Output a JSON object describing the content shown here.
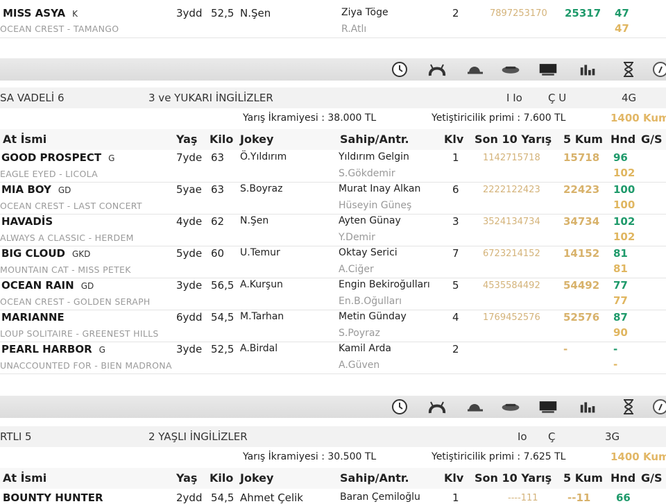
{
  "top_entry": {
    "name": "MISS ASYA",
    "tag": "K",
    "age": "3ydd",
    "kilo": "52,5",
    "jockey": "N.Şen",
    "owner": "Ziya Töge",
    "trainer": "R.Atlı",
    "klv": "2",
    "form": "7897253170",
    "kum": "25317",
    "hnd": "47",
    "hnd2": "47",
    "pedigree": "OCEAN CREST - TAMANGO"
  },
  "icons": [
    "clock-icon",
    "horseshoe-icon",
    "jockey-cap-icon",
    "saddle-icon",
    "tv-icon",
    "stats-icon",
    "hourglass-icon",
    "info-icon"
  ],
  "race1": {
    "title": "SA VADELİ 6",
    "category": "3 ve YUKARI İNGİLİZLER",
    "cond1": "I Io",
    "cond2": "Ç U",
    "cond3": "4G",
    "prize_label": "Yarış İkramiyesi : 38.000 TL",
    "breeder_label": "Yetiştiricilik primi : 7.600 TL",
    "distance": "1400 Kum",
    "headers": {
      "name": "At İsmi",
      "age": "Yaş",
      "kilo": "Kilo",
      "jockey": "Jokey",
      "owner": "Sahip/Antr.",
      "klv": "Klv",
      "form": "Son 10 Yarış",
      "kum": "5 Kum",
      "hnd": "Hnd",
      "gs": "G/S"
    },
    "rows": [
      {
        "name": "GOOD PROSPECT",
        "tag": "G",
        "pedigree": "EAGLE EYED - LICOLA",
        "age": "7yde",
        "kilo": "63",
        "jockey": "Ö.Yıldırım",
        "owner": "Yıldırım Gelgin",
        "trainer": "S.Gökdemir",
        "klv": "1",
        "form": "1142715718",
        "kum": "15718",
        "hnd": "96",
        "hnd2": "102"
      },
      {
        "name": "MIA BOY",
        "tag": "GD",
        "pedigree": "OCEAN CREST - LAST CONCERT",
        "age": "5yae",
        "kilo": "63",
        "jockey": "S.Boyraz",
        "owner": "Murat Inay Alkan",
        "trainer": "Hüseyin Güneş",
        "klv": "6",
        "form": "2222122423",
        "kum": "22423",
        "hnd": "100",
        "hnd2": "100"
      },
      {
        "name": "HAVADİS",
        "tag": "",
        "pedigree": "ALWAYS A CLASSIC - HERDEM",
        "age": "4yde",
        "kilo": "62",
        "jockey": "N.Şen",
        "owner": "Ayten Günay",
        "trainer": "Y.Demir",
        "klv": "3",
        "form": "3524134734",
        "kum": "34734",
        "hnd": "102",
        "hnd2": "102"
      },
      {
        "name": "BIG CLOUD",
        "tag": "GKD",
        "pedigree": "MOUNTAIN CAT - MISS PETEK",
        "age": "5yde",
        "kilo": "60",
        "jockey": "U.Temur",
        "owner": "Oktay Serici",
        "trainer": "A.Ciğer",
        "klv": "7",
        "form": "6723214152",
        "kum": "14152",
        "hnd": "81",
        "hnd2": "81"
      },
      {
        "name": "OCEAN RAIN",
        "tag": "GD",
        "pedigree": "OCEAN CREST - GOLDEN SERAPH",
        "age": "3yde",
        "kilo": "56,5",
        "jockey": "A.Kurşun",
        "owner": "Engin Bekiroğulları",
        "trainer": "En.B.Oğulları",
        "klv": "5",
        "form": "4535584492",
        "kum": "54492",
        "hnd": "77",
        "hnd2": "77"
      },
      {
        "name": "MARIANNE",
        "tag": "",
        "pedigree": "LOUP SOLITAIRE - GREENEST HILLS",
        "age": "6ydd",
        "kilo": "54,5",
        "jockey": "M.Tarhan",
        "owner": "Metin Günday",
        "trainer": "S.Poyraz",
        "klv": "4",
        "form": "1769452576",
        "kum": "52576",
        "hnd": "87",
        "hnd2": "90"
      },
      {
        "name": "PEARL HARBOR",
        "tag": "G",
        "pedigree": "UNACCOUNTED FOR - BIEN MADRONA",
        "age": "3yde",
        "kilo": "52,5",
        "jockey": "A.Birdal",
        "owner": "Kamil Arda",
        "trainer": "A.Güven",
        "klv": "2",
        "form": "",
        "kum": "-",
        "hnd": "-",
        "hnd2": "-"
      }
    ]
  },
  "race2": {
    "title": "RTLI 5",
    "category": "2 YAŞLI İNGİLİZLER",
    "cond1": "Io",
    "cond2": "Ç",
    "cond3": "3G",
    "prize_label": "Yarış İkramiyesi : 30.500 TL",
    "breeder_label": "Yetiştiricilik primi : 7.625 TL",
    "distance": "1400 Kum",
    "headers": {
      "name": "At İsmi",
      "age": "Yaş",
      "kilo": "Kilo",
      "jockey": "Jokey",
      "owner": "Sahip/Antr.",
      "klv": "Klv",
      "form": "Son 10 Yarış",
      "kum": "5 Kum",
      "hnd": "Hnd",
      "gs": "G/S"
    },
    "rows": [
      {
        "name": "BOUNTY HUNTER",
        "age": "2ydd",
        "kilo": "54,5",
        "jockey": "Ahmet Çelik",
        "owner": "Baran Çemiloğlu",
        "klv": "1",
        "form": "----111",
        "kum": "--11",
        "hnd": "66"
      }
    ]
  }
}
